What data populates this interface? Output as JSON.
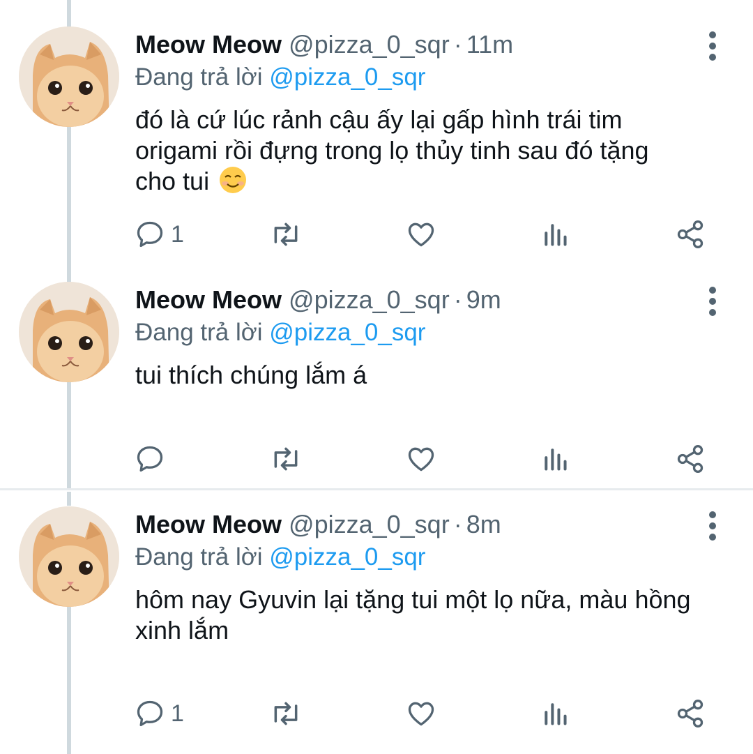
{
  "tweets": [
    {
      "name": "Meow Meow",
      "handle": "@pizza_0_sqr",
      "separator": "·",
      "time": "11m",
      "reply_prefix": "Đang trả lời",
      "reply_to": "@pizza_0_sqr",
      "text_lines": [
        "đó là cứ lúc rảnh cậu ấy lại gấp hình trái tim",
        "origami rồi đựng trong lọ thủy tinh sau đó tặng",
        "cho tui"
      ],
      "emoji": "smiling-face-emoji",
      "reply_count": "1"
    },
    {
      "name": "Meow Meow",
      "handle": "@pizza_0_sqr",
      "separator": "·",
      "time": "9m",
      "reply_prefix": "Đang trả lời",
      "reply_to": "@pizza_0_sqr",
      "text_lines": [
        "tui thích chúng lắm á"
      ],
      "reply_count": ""
    },
    {
      "name": "Meow Meow",
      "handle": "@pizza_0_sqr",
      "separator": "·",
      "time": "8m",
      "reply_prefix": "Đang trả lời",
      "reply_to": "@pizza_0_sqr",
      "text_lines": [
        "hôm nay Gyuvin lại tặng tui một lọ nữa, màu hồng",
        "xinh lắm"
      ],
      "reply_count": "1"
    }
  ],
  "icons": {
    "reply": "reply-icon",
    "retweet": "retweet-icon",
    "like": "heart-icon",
    "views": "analytics-icon",
    "share": "share-icon",
    "more": "more-vertical-icon"
  },
  "colors": {
    "text": "#0f1419",
    "secondary": "#536471",
    "mention": "#1d9bf0",
    "thread_line": "#cfd9de",
    "separator": "#e7ebee"
  }
}
